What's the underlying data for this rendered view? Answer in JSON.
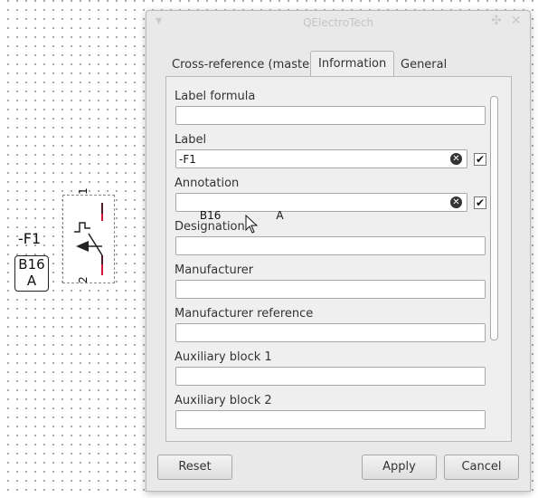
{
  "canvas": {
    "label": "-F1",
    "annotation_line1": "B16",
    "annotation_line2": "A",
    "pin_top": "1",
    "pin_bottom": "2"
  },
  "dialog": {
    "title": "QElectroTech",
    "tabs": [
      {
        "label": "Cross-reference (master)",
        "active": false
      },
      {
        "label": "Information",
        "active": true
      },
      {
        "label": "General",
        "active": false
      }
    ],
    "fields": [
      {
        "label": "Label formula",
        "value": ""
      },
      {
        "label": "Label",
        "value": "-F1",
        "checked": true
      },
      {
        "label": "Annotation",
        "value": "B16                A",
        "checked": true
      },
      {
        "label": "Designation",
        "value": ""
      },
      {
        "label": "Manufacturer",
        "value": ""
      },
      {
        "label": "Manufacturer reference",
        "value": ""
      },
      {
        "label": "Auxiliary block 1",
        "value": ""
      },
      {
        "label": "Auxiliary block 2",
        "value": ""
      }
    ],
    "buttons": {
      "reset": "Reset",
      "apply": "Apply",
      "cancel": "Cancel"
    }
  },
  "colors": {
    "pin_accent": "#d0153a"
  },
  "icons": {
    "clear": "clear-icon",
    "close": "close-icon",
    "pin": "pin-icon",
    "menu": "window-menu-icon"
  }
}
